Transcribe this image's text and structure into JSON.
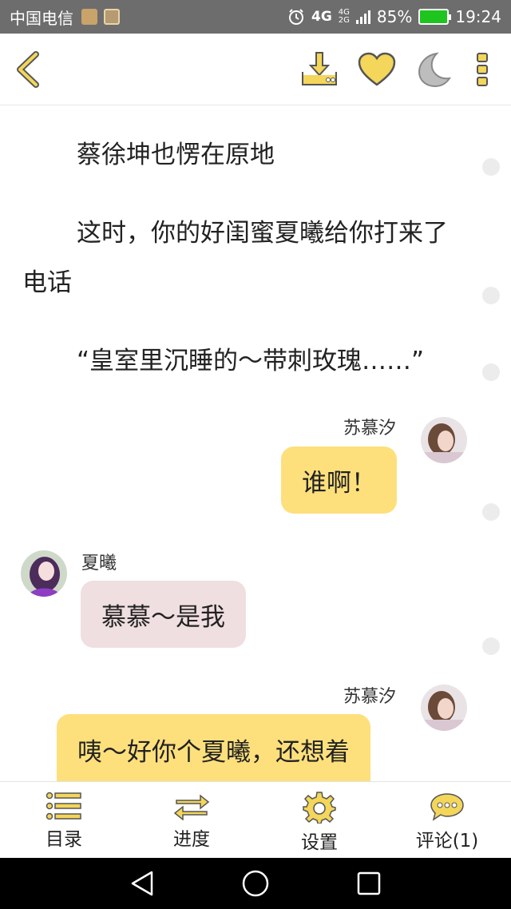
{
  "status_bar": {
    "carrier": "中国电信",
    "network": "4G",
    "network_small_top": "4G",
    "network_small_bottom": "2G",
    "battery": "85%",
    "time": "19:24"
  },
  "toolbar": {
    "icons": [
      "back-chevron",
      "download",
      "heart",
      "moon",
      "more-vertical"
    ],
    "accent_color": "#f3d65a"
  },
  "content": {
    "paragraphs": [
      "蔡徐坤也愣在原地",
      "这时，你的好闺蜜夏曦给你打来了电话",
      "“皇室里沉睡的～带刺玫瑰……”"
    ],
    "messages": [
      {
        "sender": "苏慕汐",
        "text": "谁啊！",
        "side": "right",
        "bubble_color": "#fde07c"
      },
      {
        "sender": "夏曦",
        "text": "慕慕～是我",
        "side": "left",
        "bubble_color": "#f0dfe0"
      },
      {
        "sender": "苏慕汐",
        "text": "咦～好你个夏曦，还想着",
        "side": "right",
        "bubble_color": "#fde07c"
      }
    ]
  },
  "bottom_nav": {
    "items": [
      {
        "label": "目录",
        "icon": "list-icon"
      },
      {
        "label": "进度",
        "icon": "swap-arrows-icon"
      },
      {
        "label": "设置",
        "icon": "gear-icon"
      },
      {
        "label": "评论(1)",
        "icon": "comment-icon"
      }
    ]
  }
}
